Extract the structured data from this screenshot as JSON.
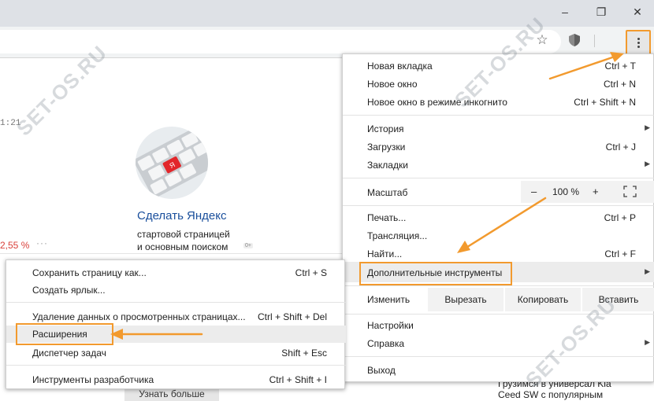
{
  "window": {
    "minimize_glyph": "–",
    "maximize_glyph": "❐",
    "close_glyph": "✕"
  },
  "toolbar": {
    "bookmark_icon": "star-icon",
    "extension_icon": "shield-icon",
    "menu_icon": "kebab-menu-icon",
    "accent_color": "#f29a2e"
  },
  "page": {
    "time_fragment": "1:21",
    "percent": "2,55 %",
    "dots": "···",
    "promo": {
      "title": "Сделать Яндекс",
      "line1": "стартовой страницей",
      "line2": "и основным поиском",
      "badge": "0+",
      "key_letter": "Я"
    },
    "learn_more": "Узнать больше",
    "news": "Грузимся в универсал Kia Ceed SW с популярным"
  },
  "watermark": "SET-OS.RU",
  "main_menu": {
    "items_group1": [
      {
        "label": "Новая вкладка",
        "shortcut": "Ctrl + T"
      },
      {
        "label": "Новое окно",
        "shortcut": "Ctrl + N"
      },
      {
        "label": "Новое окно в режиме инкогнито",
        "shortcut": "Ctrl + Shift + N"
      }
    ],
    "items_group2": [
      {
        "label": "История",
        "shortcut": "",
        "submenu": true
      },
      {
        "label": "Загрузки",
        "shortcut": "Ctrl + J",
        "submenu": false
      },
      {
        "label": "Закладки",
        "shortcut": "",
        "submenu": true
      }
    ],
    "zoom": {
      "label": "Масштаб",
      "minus": "–",
      "value": "100 %",
      "plus": "+"
    },
    "items_group3": [
      {
        "label": "Печать...",
        "shortcut": "Ctrl + P"
      },
      {
        "label": "Трансляция...",
        "shortcut": ""
      },
      {
        "label": "Найти...",
        "shortcut": "Ctrl + F"
      }
    ],
    "more_tools": {
      "label": "Дополнительные инструменты",
      "arrow": "▶"
    },
    "edit": {
      "label": "Изменить",
      "cut": "Вырезать",
      "copy": "Копировать",
      "paste": "Вставить"
    },
    "items_group4": [
      {
        "label": "Настройки",
        "submenu": false
      },
      {
        "label": "Справка",
        "submenu": true
      }
    ],
    "exit": {
      "label": "Выход"
    },
    "arrow_glyph": "▶"
  },
  "sub_menu": {
    "items": [
      {
        "label": "Сохранить страницу как...",
        "shortcut": "Ctrl + S"
      },
      {
        "label": "Создать ярлык...",
        "shortcut": ""
      },
      {
        "label": "Удаление данных о просмотренных страницах...",
        "shortcut": "Ctrl + Shift + Del"
      },
      {
        "label": "Расширения",
        "shortcut": ""
      },
      {
        "label": "Диспетчер задач",
        "shortcut": "Shift + Esc"
      },
      {
        "label": "Инструменты разработчика",
        "shortcut": "Ctrl + Shift + I"
      }
    ]
  }
}
